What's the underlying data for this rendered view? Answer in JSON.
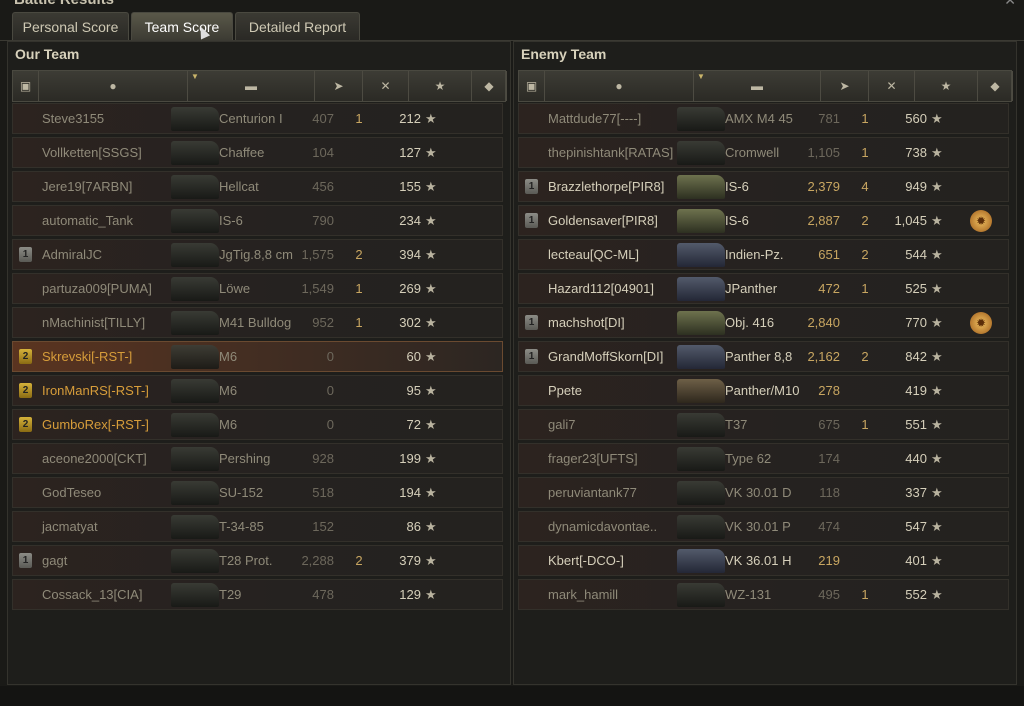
{
  "window": {
    "title": "Battle Results"
  },
  "tabs": [
    "Personal Score",
    "Team Score",
    "Detailed Report"
  ],
  "active_tab": 1,
  "our_team": {
    "title": "Our Team",
    "rows": [
      {
        "name": "Steve3155",
        "tank": "Centurion I",
        "damage": "407",
        "kills": "1",
        "xp": "212",
        "badge": "",
        "style": "dim",
        "tank_color": "dark",
        "medal": false
      },
      {
        "name": "Vollketten[SSGS]",
        "tank": "Chaffee",
        "damage": "104",
        "kills": "",
        "xp": "127",
        "badge": "",
        "style": "dim",
        "tank_color": "dark",
        "medal": false
      },
      {
        "name": "Jere19[7ARBN]",
        "tank": "Hellcat",
        "damage": "456",
        "kills": "",
        "xp": "155",
        "badge": "",
        "style": "dim",
        "tank_color": "dark",
        "medal": false
      },
      {
        "name": "automatic_Tank",
        "tank": "IS-6",
        "damage": "790",
        "kills": "",
        "xp": "234",
        "badge": "",
        "style": "dim",
        "tank_color": "dark",
        "medal": false
      },
      {
        "name": "AdmiralJC",
        "tank": "JgTig.8,8 cm",
        "damage": "1,575",
        "kills": "2",
        "xp": "394",
        "badge": "silver",
        "style": "dim",
        "tank_color": "dark",
        "medal": false
      },
      {
        "name": "partuza009[PUMA]",
        "tank": "Löwe",
        "damage": "1,549",
        "kills": "1",
        "xp": "269",
        "badge": "",
        "style": "dim",
        "tank_color": "dark",
        "medal": false
      },
      {
        "name": "nMachinist[TILLY]",
        "tank": "M41 Bulldog",
        "damage": "952",
        "kills": "1",
        "xp": "302",
        "badge": "",
        "style": "dim",
        "tank_color": "dark",
        "medal": false
      },
      {
        "name": "Skrevski[-RST-]",
        "tank": "M6",
        "damage": "0",
        "kills": "",
        "xp": "60",
        "badge": "gold",
        "style": "gold",
        "tank_color": "dark",
        "medal": false,
        "highlight": true
      },
      {
        "name": "IronManRS[-RST-]",
        "tank": "M6",
        "damage": "0",
        "kills": "",
        "xp": "95",
        "badge": "gold",
        "style": "gold",
        "tank_color": "dark",
        "medal": false
      },
      {
        "name": "GumboRex[-RST-]",
        "tank": "M6",
        "damage": "0",
        "kills": "",
        "xp": "72",
        "badge": "gold",
        "style": "gold",
        "tank_color": "dark",
        "medal": false
      },
      {
        "name": "aceone2000[CKT]",
        "tank": "Pershing",
        "damage": "928",
        "kills": "",
        "xp": "199",
        "badge": "",
        "style": "dim",
        "tank_color": "dark",
        "medal": false
      },
      {
        "name": "GodTeseo",
        "tank": "SU-152",
        "damage": "518",
        "kills": "",
        "xp": "194",
        "badge": "",
        "style": "dim",
        "tank_color": "dark",
        "medal": false
      },
      {
        "name": "jacmatyat",
        "tank": "T-34-85",
        "damage": "152",
        "kills": "",
        "xp": "86",
        "badge": "",
        "style": "dim",
        "tank_color": "dark",
        "medal": false
      },
      {
        "name": "gagt",
        "tank": "T28 Prot.",
        "damage": "2,288",
        "kills": "2",
        "xp": "379",
        "badge": "silver",
        "style": "dim",
        "tank_color": "dark",
        "medal": false
      },
      {
        "name": "Cossack_13[CIA]",
        "tank": "T29",
        "damage": "478",
        "kills": "",
        "xp": "129",
        "badge": "",
        "style": "dim",
        "tank_color": "dark",
        "medal": false
      }
    ]
  },
  "enemy_team": {
    "title": "Enemy Team",
    "rows": [
      {
        "name": "Mattdude77[----]",
        "tank": "AMX M4 45",
        "damage": "781",
        "kills": "1",
        "xp": "560",
        "badge": "",
        "style": "dim",
        "tank_color": "dark",
        "medal": false
      },
      {
        "name": "thepinishtank[RATAS]",
        "tank": "Cromwell",
        "damage": "1,105",
        "kills": "1",
        "xp": "738",
        "badge": "",
        "style": "dim",
        "tank_color": "dark",
        "medal": false
      },
      {
        "name": "Brazzlethorpe[PIR8]",
        "tank": "IS-6",
        "damage": "2,379",
        "kills": "4",
        "xp": "949",
        "badge": "silver",
        "style": "bright",
        "tank_color": "light",
        "medal": false
      },
      {
        "name": "Goldensaver[PIR8]",
        "tank": "IS-6",
        "damage": "2,887",
        "kills": "2",
        "xp": "1,045",
        "badge": "silver",
        "style": "bright",
        "tank_color": "light",
        "medal": true
      },
      {
        "name": "lecteau[QC-ML]",
        "tank": "Indien-Pz.",
        "damage": "651",
        "kills": "2",
        "xp": "544",
        "badge": "",
        "style": "bright",
        "tank_color": "blue",
        "medal": false
      },
      {
        "name": "Hazard112[04901]",
        "tank": "JPanther",
        "damage": "472",
        "kills": "1",
        "xp": "525",
        "badge": "",
        "style": "bright",
        "tank_color": "blue",
        "medal": false
      },
      {
        "name": "machshot[DI]",
        "tank": "Obj. 416",
        "damage": "2,840",
        "kills": "",
        "xp": "770",
        "badge": "silver",
        "style": "bright",
        "tank_color": "light",
        "medal": true
      },
      {
        "name": "GrandMoffSkorn[DI]",
        "tank": "Panther 8,8",
        "damage": "2,162",
        "kills": "2",
        "xp": "842",
        "badge": "silver",
        "style": "bright",
        "tank_color": "blue",
        "medal": false
      },
      {
        "name": "Ppete",
        "tank": "Panther/M10",
        "damage": "278",
        "kills": "",
        "xp": "419",
        "badge": "",
        "style": "bright",
        "tank_color": "tan",
        "medal": false
      },
      {
        "name": "gali7",
        "tank": "T37",
        "damage": "675",
        "kills": "1",
        "xp": "551",
        "badge": "",
        "style": "dim",
        "tank_color": "dark",
        "medal": false
      },
      {
        "name": "frager23[UFTS]",
        "tank": "Type 62",
        "damage": "174",
        "kills": "",
        "xp": "440",
        "badge": "",
        "style": "dim",
        "tank_color": "dark",
        "medal": false
      },
      {
        "name": "peruviantank77",
        "tank": "VK 30.01 D",
        "damage": "118",
        "kills": "",
        "xp": "337",
        "badge": "",
        "style": "dim",
        "tank_color": "dark",
        "medal": false
      },
      {
        "name": "dynamicdavontae..",
        "tank": "VK 30.01 P",
        "damage": "474",
        "kills": "",
        "xp": "547",
        "badge": "",
        "style": "dim",
        "tank_color": "dark",
        "medal": false
      },
      {
        "name": "Kbert[-DCO-]",
        "tank": "VK 36.01 H",
        "damage": "219",
        "kills": "",
        "xp": "401",
        "badge": "",
        "style": "bright",
        "tank_color": "blue",
        "medal": false
      },
      {
        "name": "mark_hamill",
        "tank": "WZ-131",
        "damage": "495",
        "kills": "1",
        "xp": "552",
        "badge": "",
        "style": "dim",
        "tank_color": "dark",
        "medal": false
      }
    ]
  },
  "header_icons": [
    "platoon-icon",
    "player-icon",
    "tank-icon",
    "damage-icon",
    "kills-icon",
    "xp-star-icon",
    "medal-icon"
  ],
  "colors": {
    "gold_name": "#d79d3a",
    "bright_value": "#c8a661",
    "highlight_row": "#5a3420"
  }
}
